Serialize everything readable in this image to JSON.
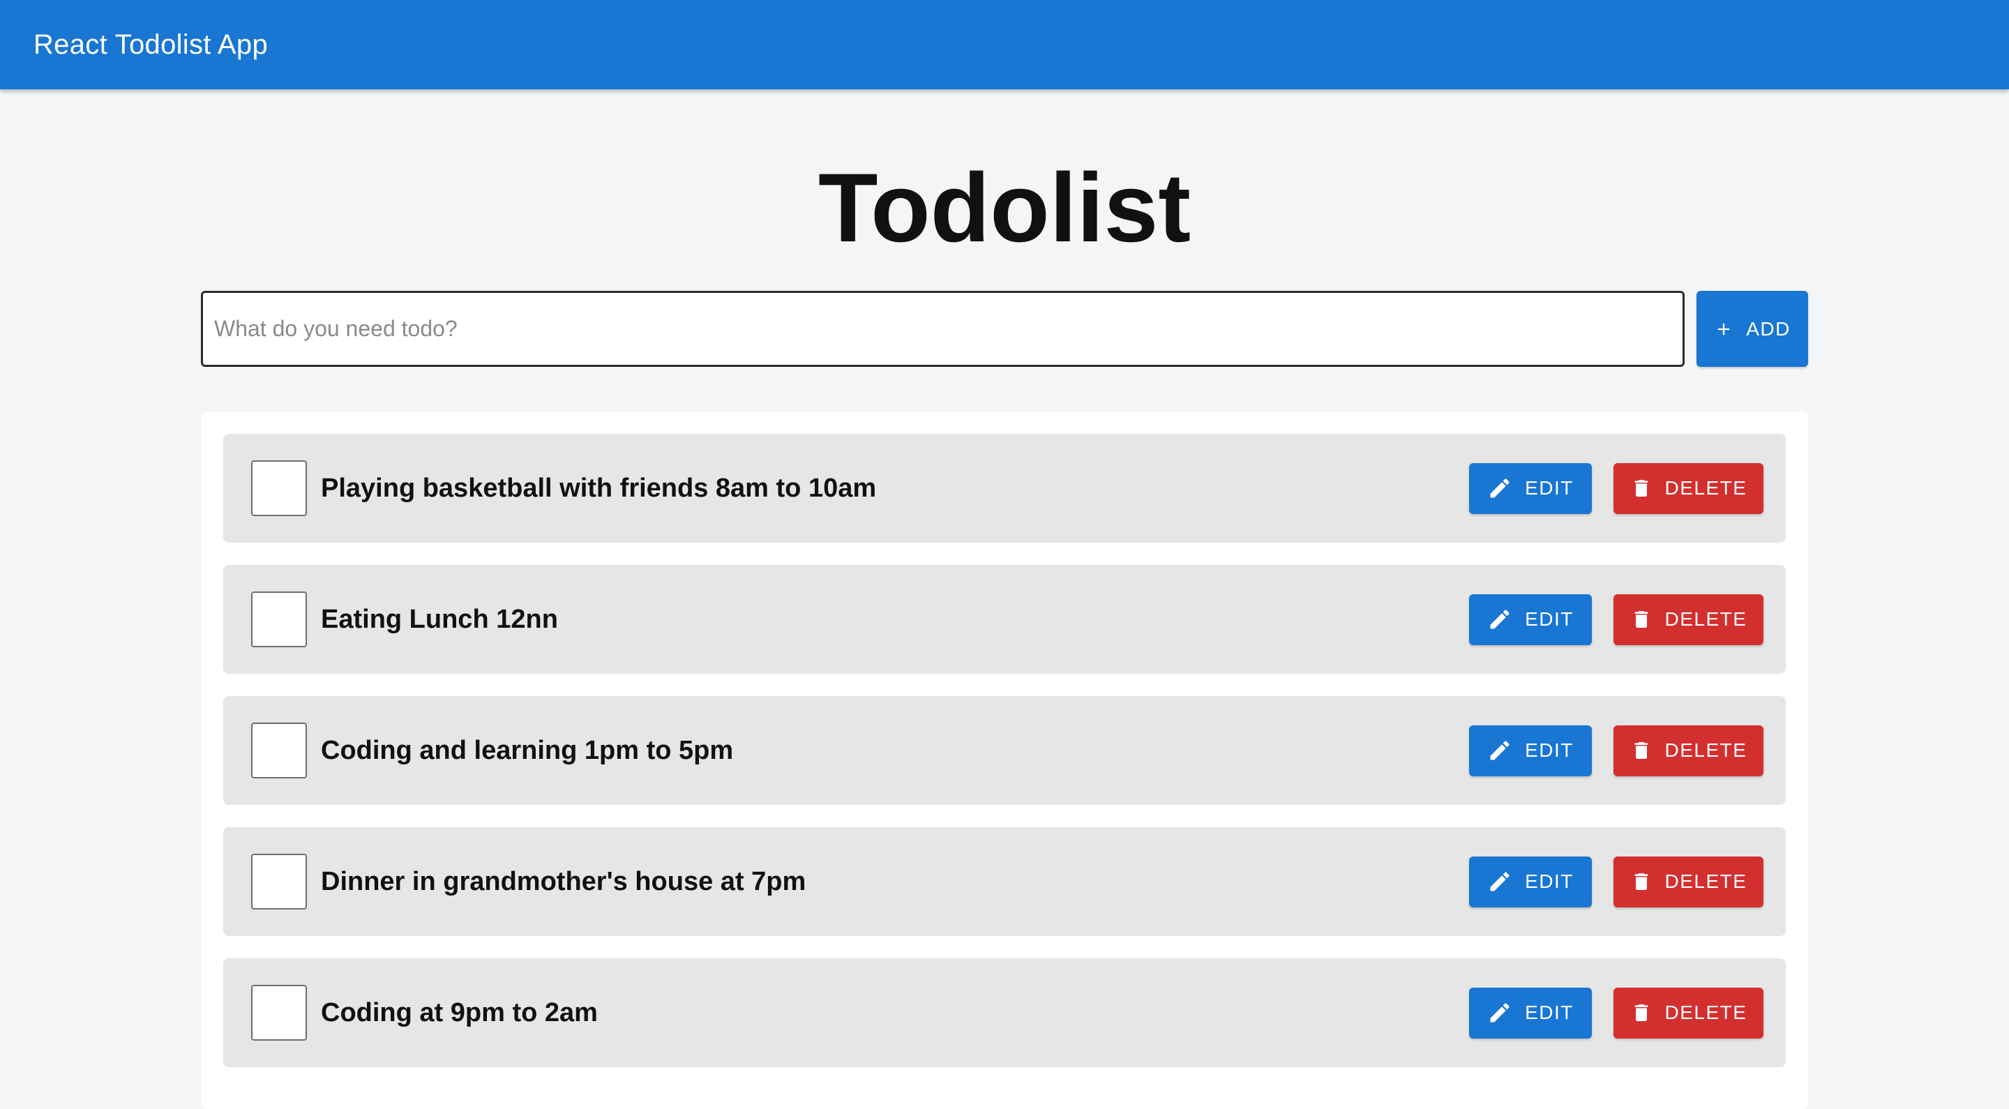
{
  "appbar": {
    "title": "React Todolist App",
    "color": "#1976d2"
  },
  "main": {
    "title": "Todolist"
  },
  "add_form": {
    "placeholder": "What do you need todo?",
    "value": "",
    "add_label": "ADD",
    "add_icon": "plus-icon"
  },
  "todos": [
    {
      "text": "Playing basketball with friends 8am to 10am",
      "completed": false,
      "edit_label": "EDIT",
      "delete_label": "DELETE"
    },
    {
      "text": "Eating Lunch 12nn",
      "completed": false,
      "edit_label": "EDIT",
      "delete_label": "DELETE"
    },
    {
      "text": "Coding and learning 1pm to 5pm",
      "completed": false,
      "edit_label": "EDIT",
      "delete_label": "DELETE"
    },
    {
      "text": "Dinner in grandmother's house at 7pm",
      "completed": false,
      "edit_label": "EDIT",
      "delete_label": "DELETE"
    },
    {
      "text": "Coding at 9pm to 2am",
      "completed": false,
      "edit_label": "EDIT",
      "delete_label": "DELETE"
    }
  ],
  "icons": {
    "edit": "pencil-icon",
    "delete": "trash-icon"
  },
  "colors": {
    "primary": "#1976d2",
    "danger": "#d32f2f",
    "item_background": "#e6e6e6",
    "page_background": "#f4f5f7"
  }
}
